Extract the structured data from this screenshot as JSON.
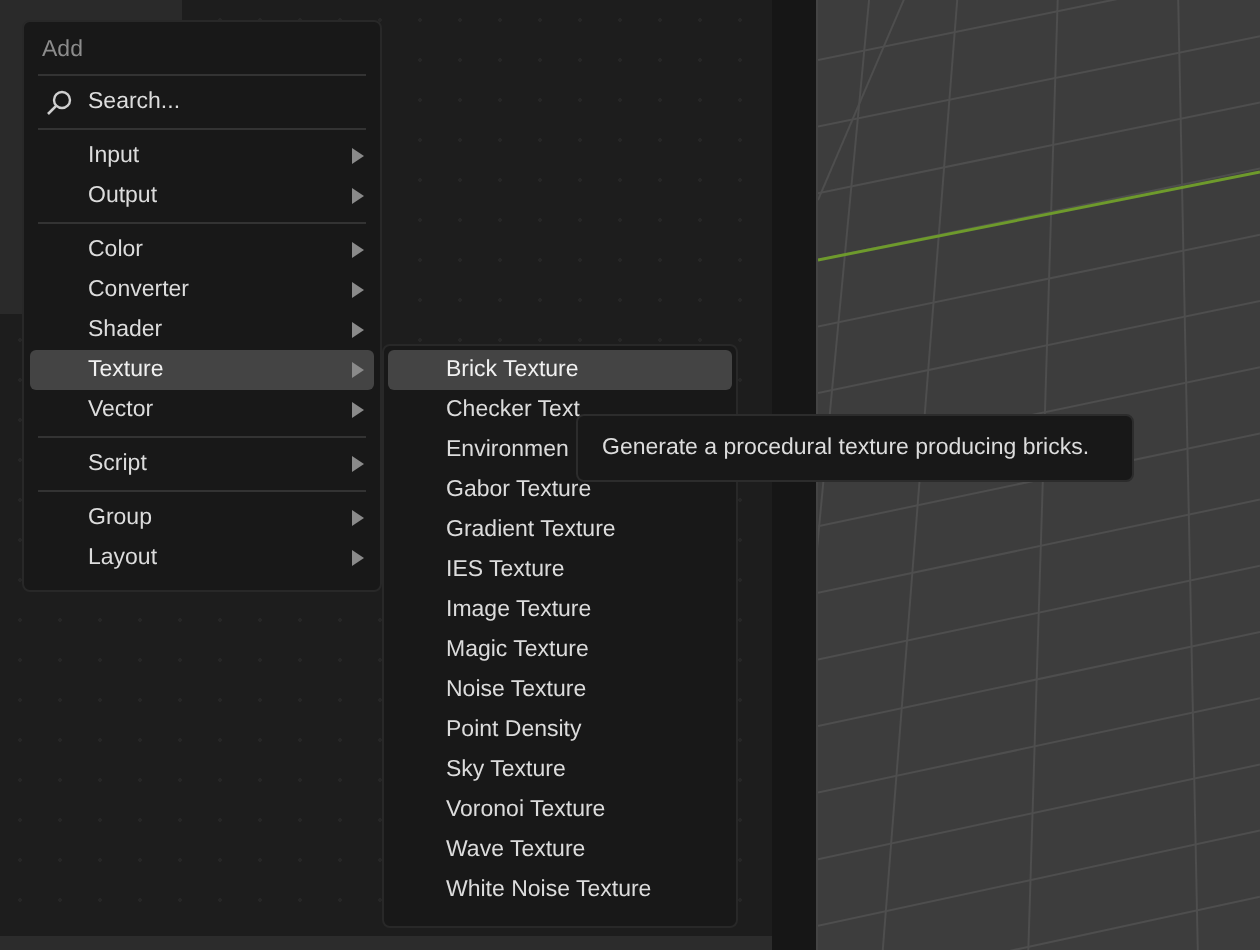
{
  "add_menu": {
    "title": "Add",
    "groups": [
      [
        {
          "kind": "search",
          "label": "Search...",
          "selected": false
        }
      ],
      [
        {
          "kind": "submenu",
          "label": "Input",
          "selected": false
        },
        {
          "kind": "submenu",
          "label": "Output",
          "selected": false
        }
      ],
      [
        {
          "kind": "submenu",
          "label": "Color",
          "selected": false
        },
        {
          "kind": "submenu",
          "label": "Converter",
          "selected": false
        },
        {
          "kind": "submenu",
          "label": "Shader",
          "selected": false
        },
        {
          "kind": "submenu",
          "label": "Texture",
          "selected": true
        },
        {
          "kind": "submenu",
          "label": "Vector",
          "selected": false
        }
      ],
      [
        {
          "kind": "submenu",
          "label": "Script",
          "selected": false
        }
      ],
      [
        {
          "kind": "submenu",
          "label": "Group",
          "selected": false
        },
        {
          "kind": "submenu",
          "label": "Layout",
          "selected": false
        }
      ]
    ]
  },
  "texture_menu": {
    "items": [
      {
        "label": "Brick Texture",
        "selected": true
      },
      {
        "label": "Checker Text",
        "selected": false
      },
      {
        "label": "Environmen",
        "selected": false
      },
      {
        "label": "Gabor Texture",
        "selected": false
      },
      {
        "label": "Gradient Texture",
        "selected": false
      },
      {
        "label": "IES Texture",
        "selected": false
      },
      {
        "label": "Image Texture",
        "selected": false
      },
      {
        "label": "Magic Texture",
        "selected": false
      },
      {
        "label": "Noise Texture",
        "selected": false
      },
      {
        "label": "Point Density",
        "selected": false
      },
      {
        "label": "Sky Texture",
        "selected": false
      },
      {
        "label": "Voronoi Texture",
        "selected": false
      },
      {
        "label": "Wave Texture",
        "selected": false
      },
      {
        "label": "White Noise Texture",
        "selected": false
      }
    ]
  },
  "tooltip": {
    "text": "Generate a procedural texture producing bricks."
  }
}
